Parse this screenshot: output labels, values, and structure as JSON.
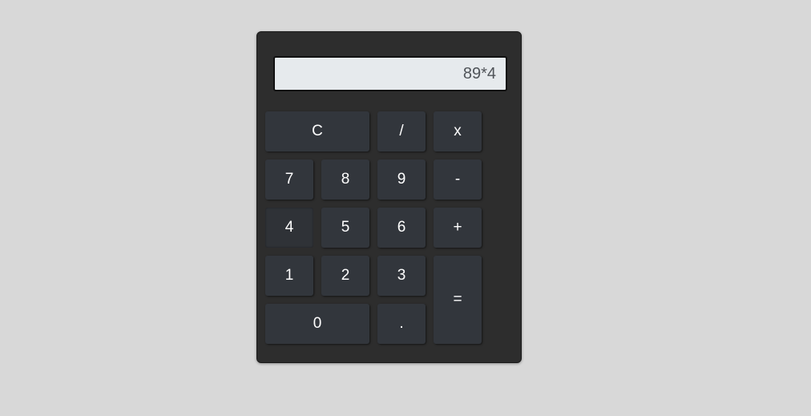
{
  "display": {
    "value": "89*4"
  },
  "keys": {
    "clear": "C",
    "divide": "/",
    "multiply": "x",
    "seven": "7",
    "eight": "8",
    "nine": "9",
    "subtract": "-",
    "four": "4",
    "five": "5",
    "six": "6",
    "add": "+",
    "one": "1",
    "two": "2",
    "three": "3",
    "equals": "=",
    "zero": "0",
    "decimal": "."
  },
  "colors": {
    "page_background": "#d8d8d8",
    "body": "#2d2d2d",
    "display_background": "#e6eaed",
    "key_background": "#32363c",
    "key_text": "#ffffff"
  }
}
